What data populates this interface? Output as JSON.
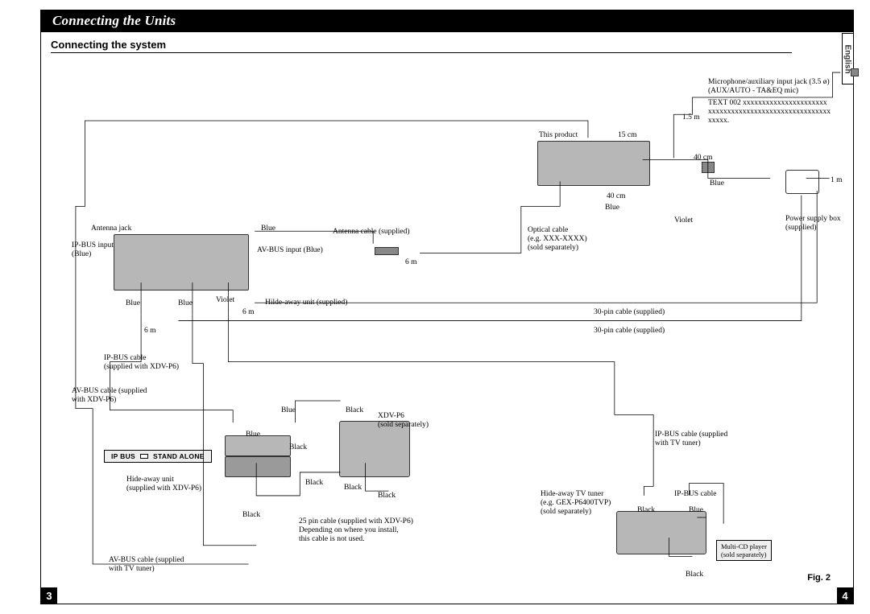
{
  "header": {
    "title": "Connecting the Units",
    "subsection": "Connecting the system",
    "language": "English",
    "figure": "Fig. 2",
    "page_left": "3",
    "page_right": "4"
  },
  "labels": {
    "mic_jack": "Microphone/auxiliary input jack (3.5 ø)\n(AUX/AUTO - TA&EQ mic)",
    "text002": "TEXT 002 xxxxxxxxxxxxxxxxxxxxxx\nxxxxxxxxxxxxxxxxxxxxxxxxxxxxxxxx\nxxxxx.",
    "len_1_5m": "1.5 m",
    "this_product": "This product",
    "len_15cm": "15 cm",
    "len_40cm_a": "40 cm",
    "len_40cm_b": "40 cm",
    "len_1m": "1 m",
    "blue_a": "Blue",
    "blue_b": "Blue",
    "violet_a": "Violet",
    "power_box": "Power supply box\n(supplied)",
    "optical_cable": "Optical cable\n(e.g. XXX-XXXX)\n(sold separately)",
    "antenna_jack": "Antenna jack",
    "ipbus_input_blue": "IP-BUS input\n(Blue)",
    "avbus_input_blue": "AV-BUS input (Blue)",
    "antenna_cable": "Antenna cable (supplied)",
    "len_6m_a": "6 m",
    "len_6m_b": "6 m",
    "len_6m_c": "6 m",
    "blue_c": "Blue",
    "blue_d": "Blue",
    "blue_e": "Blue",
    "violet_b": "Violet",
    "hideaway_supplied": "Hilde-away unit (supplied)",
    "pin30_a": "30-pin cable (supplied)",
    "pin30_b": "30-pin cable (supplied)",
    "ipbus_cable_xdv": "IP-BUS cable\n(supplied with XDV-P6)",
    "avbus_cable_xdv": "AV-BUS cable (supplied\nwith XDV-P6)",
    "blue_f": "Blue",
    "blue_g": "Blue",
    "black_a": "Black",
    "black_b": "Black",
    "black_c": "Black",
    "black_d": "Black",
    "black_e": "Black",
    "black_f": "Black",
    "black_g": "Black",
    "black_h": "Black",
    "xdvp6": "XDV-P6\n(sold separately)",
    "hideaway_xdv": "Hide-away unit\n(supplied with XDV-P6)",
    "pin25": "25 pin cable (supplied with XDV-P6)\nDepending on where you install,\nthis cable is not used.",
    "avbus_cable_tv": "AV-BUS cable (supplied\nwith TV tuner)",
    "ipbus_cable_tv": "IP-BUS cable (supplied\nwith TV tuner)",
    "ipbus_cable": "IP-BUS cable",
    "hideaway_tv": "Hide-away TV tuner\n(e.g. GEX-P6400TVP)\n(sold separately)",
    "blue_h": "Blue",
    "multi_cd": "Multi-CD player\n(sold separately)",
    "ip_bus_standalone_a": "IP BUS",
    "ip_bus_standalone_b": "STAND ALONE"
  }
}
